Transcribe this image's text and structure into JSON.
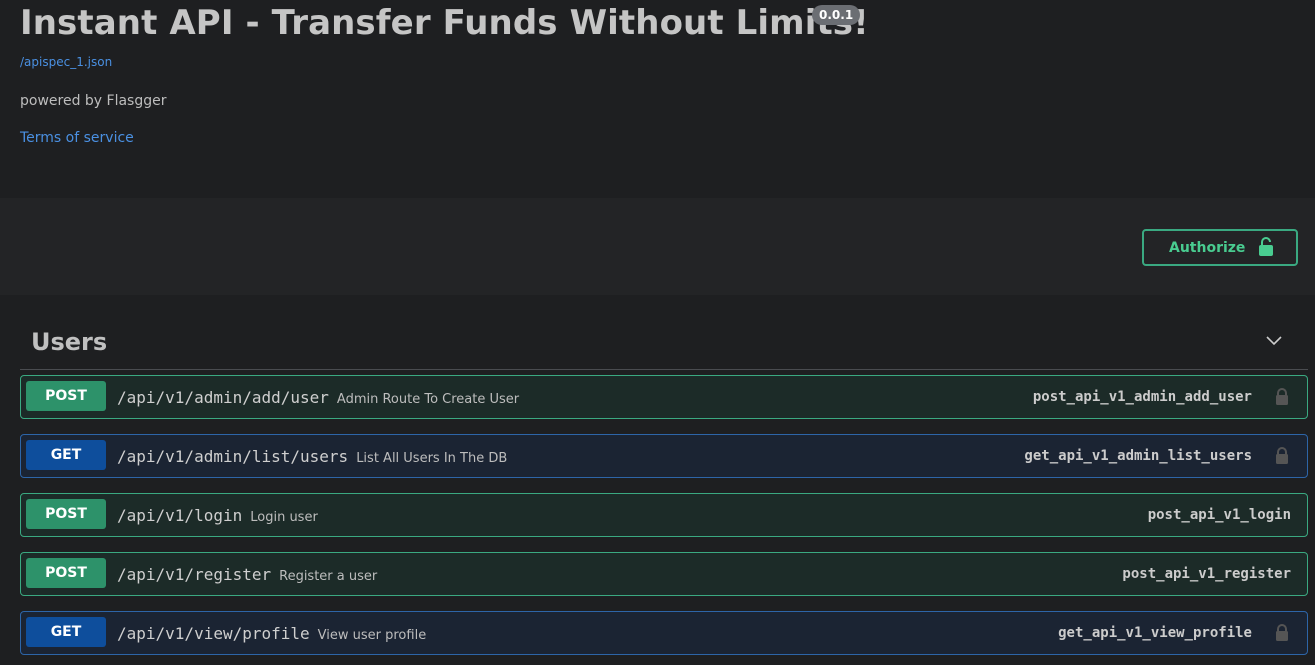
{
  "info": {
    "title": "Instant API - Transfer Funds Without Limits!",
    "version": "0.0.1",
    "spec_link": "/apispec_1.json",
    "powered_by": "powered by Flasgger",
    "terms_of_service": "Terms of service"
  },
  "auth": {
    "button_label": "Authorize",
    "lock_icon": "unlocked-lock-icon"
  },
  "tag": {
    "name": "Users",
    "chevron_icon": "chevron-down-icon"
  },
  "colors": {
    "post": "#49cc90",
    "get": "#0e4e9c",
    "background": "#1e1f21"
  },
  "operations": [
    {
      "method": "POST",
      "path": "/api/v1/admin/add/user",
      "summary": "Admin Route To Create User",
      "operation_id": "post_api_v1_admin_add_user",
      "locked": true
    },
    {
      "method": "GET",
      "path": "/api/v1/admin/list/users",
      "summary": "List All Users In The DB",
      "operation_id": "get_api_v1_admin_list_users",
      "locked": true
    },
    {
      "method": "POST",
      "path": "/api/v1/login",
      "summary": "Login user",
      "operation_id": "post_api_v1_login",
      "locked": false
    },
    {
      "method": "POST",
      "path": "/api/v1/register",
      "summary": "Register a user",
      "operation_id": "post_api_v1_register",
      "locked": false
    },
    {
      "method": "GET",
      "path": "/api/v1/view/profile",
      "summary": "View user profile",
      "operation_id": "get_api_v1_view_profile",
      "locked": true
    }
  ]
}
